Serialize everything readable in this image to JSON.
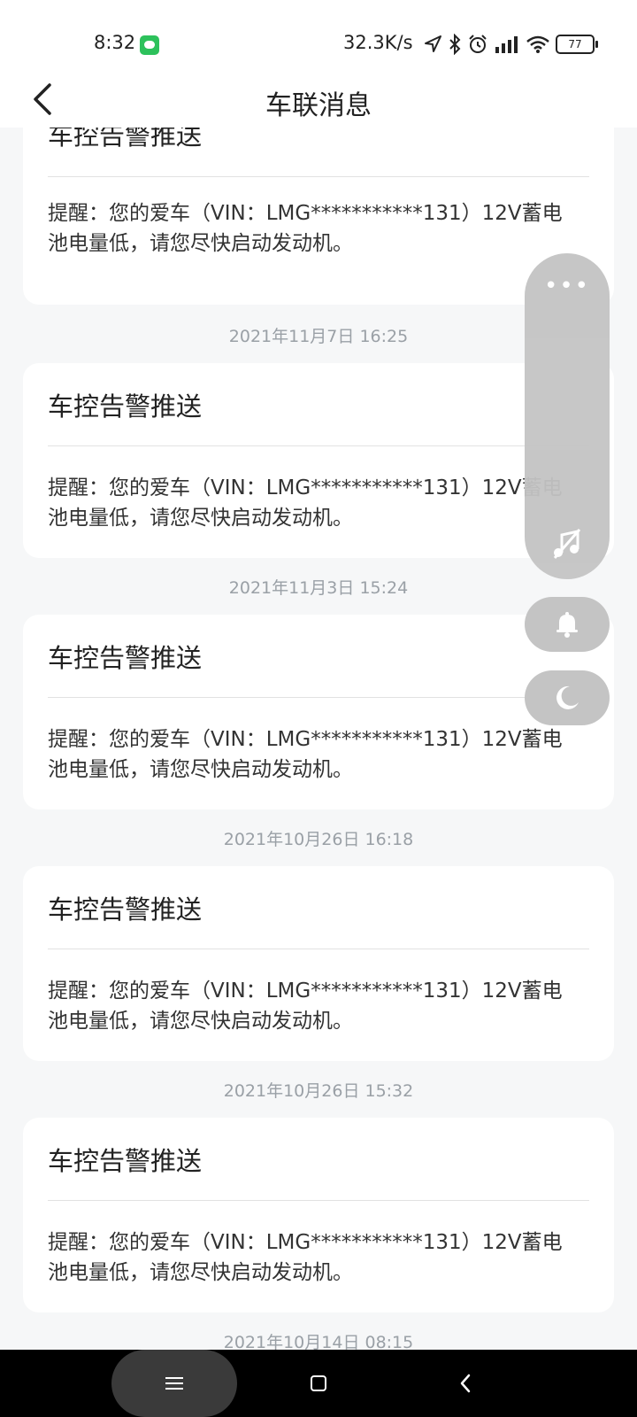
{
  "status_bar": {
    "time": "8:32",
    "net_speed": "32.3K/s",
    "battery": "77",
    "icons": [
      "wechat-icon",
      "location-icon",
      "bluetooth-icon",
      "alarm-icon",
      "signal-icon",
      "wifi-icon",
      "battery-icon"
    ]
  },
  "header": {
    "title": "车联消息",
    "back_icon": "chevron-left-icon"
  },
  "messages": [
    {
      "title": "车控告警推送",
      "body": "提醒：您的爱车（VIN：LMG***********131）12V蓄电池电量低，请您尽快启动发动机。"
    },
    {
      "timestamp": "2021年11月7日 16:25",
      "title": "车控告警推送",
      "body": "提醒：您的爱车（VIN：LMG***********131）12V蓄电池电量低，请您尽快启动发动机。"
    },
    {
      "timestamp": "2021年11月3日 15:24",
      "title": "车控告警推送",
      "body": "提醒：您的爱车（VIN：LMG***********131）12V蓄电池电量低，请您尽快启动发动机。"
    },
    {
      "timestamp": "2021年10月26日 16:18",
      "title": "车控告警推送",
      "body": "提醒：您的爱车（VIN：LMG***********131）12V蓄电池电量低，请您尽快启动发动机。"
    },
    {
      "timestamp": "2021年10月26日 15:32",
      "title": "车控告警推送",
      "body": "提醒：您的爱车（VIN：LMG***********131）12V蓄电池电量低，请您尽快启动发动机。"
    }
  ],
  "next_timestamp": "2021年10月14日 08:15",
  "floating_panel": {
    "more_label": "•••",
    "icons": [
      "more-icon",
      "music-off-icon",
      "bell-icon",
      "moon-icon"
    ]
  },
  "system_nav": {
    "icons": [
      "menu-icon",
      "home-icon",
      "back-icon"
    ]
  },
  "colors": {
    "background": "#f6f7f8",
    "card": "#ffffff",
    "timestamp": "#9aa0a6",
    "float_button": "#c4c4c4",
    "wechat": "#2dc15b"
  }
}
